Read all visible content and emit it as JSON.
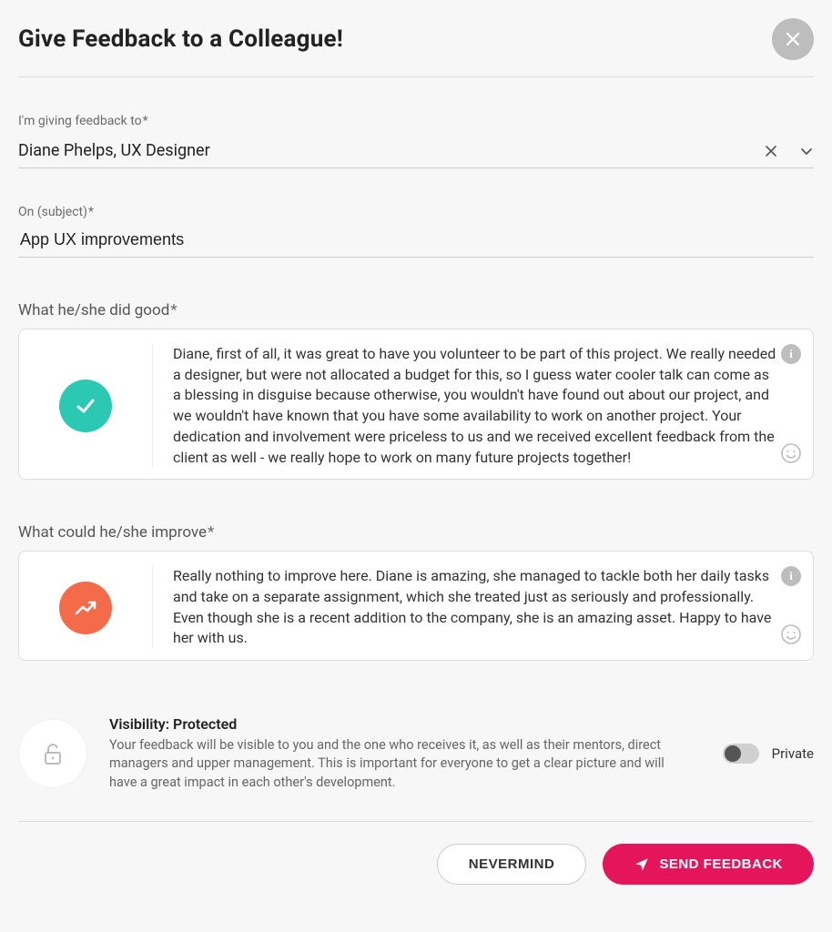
{
  "header": {
    "title": "Give Feedback to a Colleague!"
  },
  "recipient": {
    "label": "I'm giving feedback to",
    "value": "Diane Phelps, UX Designer"
  },
  "subject": {
    "label": "On (subject)",
    "value": "App UX improvements"
  },
  "good": {
    "label": "What he/she did good",
    "text": "Diane, first of all, it was great to have you volunteer to be part of this project. We really needed a designer, but were not allocated a budget for this, so I guess water cooler talk can come as a blessing in disguise because otherwise, you wouldn't have found out about our project, and we wouldn't have known that you have some availability to work on another project. Your dedication and involvement were priceless to us and we received excellent feedback from the client as well - we really hope to work on many future projects together!"
  },
  "improve": {
    "label": "What could he/she improve",
    "text": "Really nothing to improve here. Diane is amazing, she managed to tackle both her daily tasks and take on a separate assignment, which she treated just as seriously and professionally. Even though she is a recent addition to the company, she is an amazing asset. Happy to have her with us."
  },
  "visibility": {
    "title": "Visibility: Protected",
    "description": "Your feedback will be visible to you and the one who receives it, as well as their mentors, direct managers and upper management. This is important for everyone to get a clear picture and will have a great impact in each other's development.",
    "toggle_label": "Private"
  },
  "footer": {
    "cancel_label": "NEVERMIND",
    "submit_label": "SEND FEEDBACK"
  }
}
